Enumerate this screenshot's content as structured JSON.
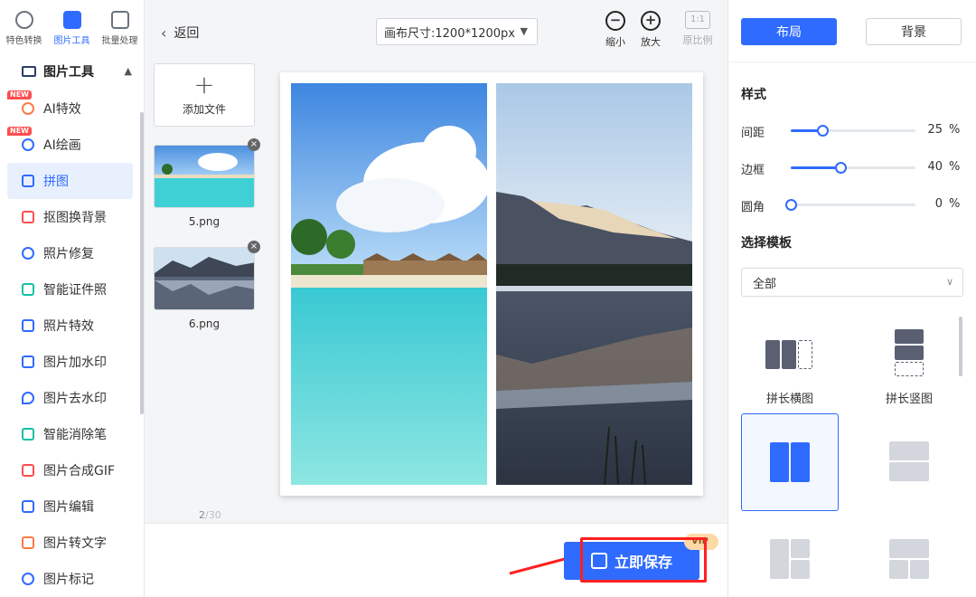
{
  "sidebar": {
    "top_tabs": [
      {
        "label": "特色转换",
        "icon": "convert-icon"
      },
      {
        "label": "图片工具",
        "icon": "image-tool-icon"
      },
      {
        "label": "批量处理",
        "icon": "batch-icon"
      }
    ],
    "section_title": "图片工具",
    "new_badge": "NEW",
    "items": [
      {
        "label": "AI特效"
      },
      {
        "label": "AI绘画"
      },
      {
        "label": "拼图"
      },
      {
        "label": "抠图换背景"
      },
      {
        "label": "照片修复"
      },
      {
        "label": "智能证件照"
      },
      {
        "label": "照片特效"
      },
      {
        "label": "图片加水印"
      },
      {
        "label": "图片去水印"
      },
      {
        "label": "智能消除笔"
      },
      {
        "label": "图片合成GIF"
      },
      {
        "label": "图片编辑"
      },
      {
        "label": "图片转文字"
      },
      {
        "label": "图片标记"
      }
    ]
  },
  "toolbar": {
    "back_label": "返回",
    "canvas_size": "画布尺寸:1200*1200px",
    "zoom_out_label": "缩小",
    "zoom_in_label": "放大",
    "original_ratio_label": "原比例",
    "original_ratio_icon": "1:1"
  },
  "files": {
    "add_label": "添加文件",
    "items": [
      {
        "name": "5.png"
      },
      {
        "name": "6.png"
      }
    ],
    "count_current": "2",
    "count_total": "/30"
  },
  "save": {
    "label": "立即保存",
    "vip": "VIP"
  },
  "right": {
    "tab_layout": "布局",
    "tab_background": "背景",
    "style_title": "样式",
    "sliders": [
      {
        "label": "间距",
        "value": 25,
        "unit": "%"
      },
      {
        "label": "边框",
        "value": 40,
        "unit": "%"
      },
      {
        "label": "圆角",
        "value": 0,
        "unit": "%"
      }
    ],
    "template_title": "选择模板",
    "template_filter": "全部",
    "templates": [
      {
        "label": "拼长横图"
      },
      {
        "label": "拼长竖图"
      }
    ]
  },
  "colors": {
    "accent": "#2f6bff",
    "highlight": "#ff2020"
  }
}
